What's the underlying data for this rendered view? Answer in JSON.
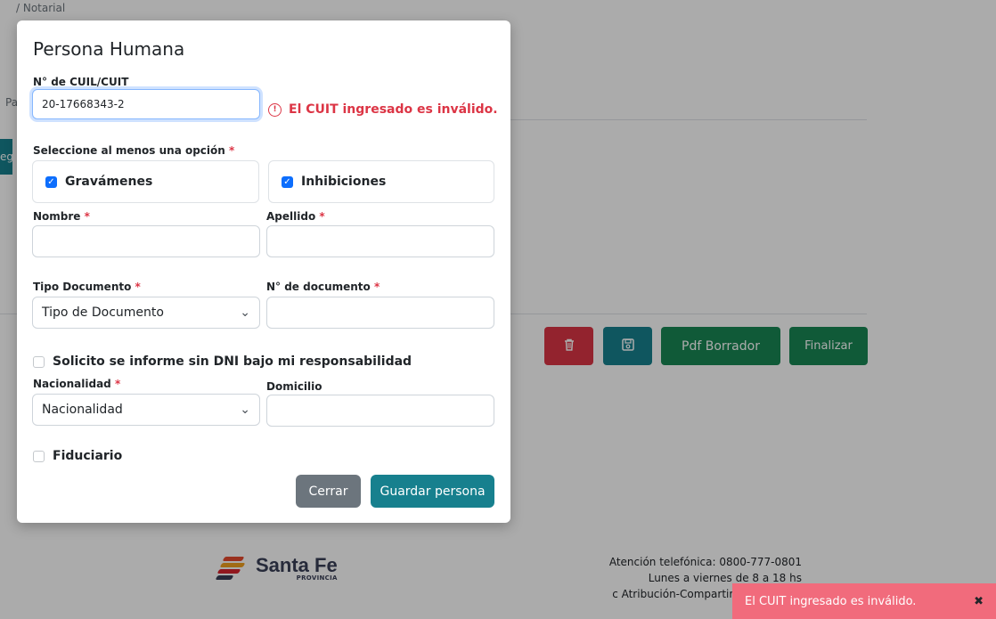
{
  "background": {
    "breadcrumb": "/ Notarial",
    "side_text": "Pa",
    "side_tab": "eg",
    "buttons": {
      "pdf_label": "Pdf Borrador",
      "finalize_label": "Finalizar"
    },
    "footer": {
      "logo_text": "Santa Fe",
      "logo_sub": "PROVINCIA",
      "phone": "Atención telefónica: 0800-777-0801",
      "hours": "Lunes a viernes de 8 a 18 hs",
      "license": "c Atribución-CompartirIgual 2.5 Arg"
    }
  },
  "modal": {
    "title": "Persona Humana",
    "cuit": {
      "label": "N° de CUIL/CUIT",
      "value": "20-17668343-2",
      "error": "El CUIT ingresado es inválido."
    },
    "options": {
      "label": "Seleccione al menos una opción",
      "gravamenes": "Gravámenes",
      "inhibiciones": "Inhibiciones"
    },
    "nombre_label": "Nombre",
    "apellido_label": "Apellido",
    "tipo_doc": {
      "label": "Tipo Documento",
      "value": "Tipo de Documento"
    },
    "nro_doc_label": "N° de documento",
    "sin_dni_label": "Solicito se informe sin DNI bajo mi responsabilidad",
    "nacionalidad": {
      "label": "Nacionalidad",
      "value": "Nacionalidad"
    },
    "domicilio_label": "Domicilio",
    "fiduciario_label": "Fiduciario",
    "close_label": "Cerrar",
    "save_label": "Guardar persona",
    "required_mark": "*"
  },
  "toast": {
    "message": "El CUIT ingresado es inválido.",
    "close": "✖"
  },
  "colors": {
    "danger": "#dc3545",
    "teal": "#17808e",
    "success": "#198754",
    "toast": "#f16b7c"
  }
}
